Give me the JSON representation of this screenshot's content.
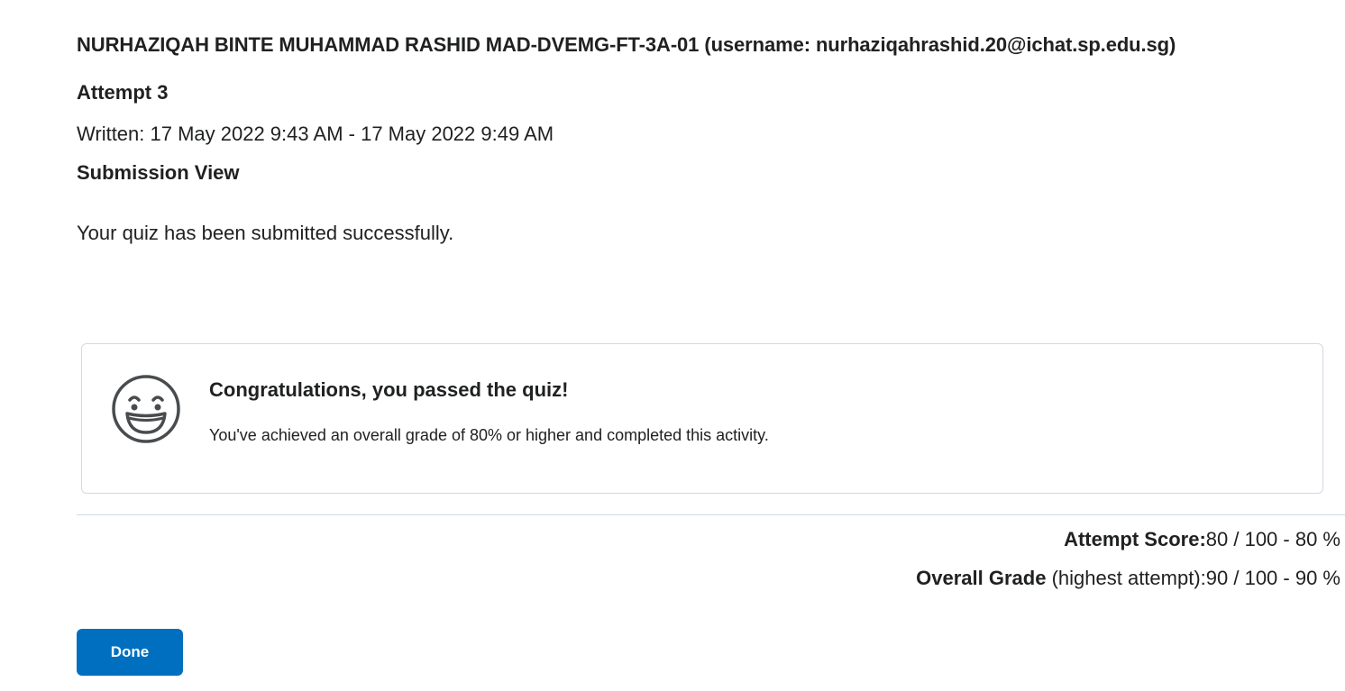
{
  "header": {
    "student_name": "NURHAZIQAH BINTE MUHAMMAD RASHID MAD-DVEMG-FT-3A-01",
    "username_text": "(username: nurhaziqahrashid.20@ichat.sp.edu.sg)",
    "attempt_title": "Attempt 3",
    "written_text": "Written: 17 May 2022 9:43 AM - 17 May 2022 9:49 AM",
    "view_title": "Submission View"
  },
  "main": {
    "submitted_message": "Your quiz has been submitted successfully."
  },
  "pass_card": {
    "icon": "smiley-icon",
    "title": "Congratulations, you passed the quiz!",
    "description": "You've achieved an overall grade of 80% or higher and completed this activity."
  },
  "scores": {
    "attempt_label": "Attempt Score:",
    "attempt_value": "80 / 100 - 80 %",
    "overall_label": "Overall Grade",
    "overall_sublabel": " (highest attempt):",
    "overall_value": "90 / 100 - 90 %"
  },
  "actions": {
    "done_label": "Done"
  },
  "colors": {
    "primary_button": "#006fbf",
    "text": "#202122",
    "border": "#d3d9e3"
  }
}
